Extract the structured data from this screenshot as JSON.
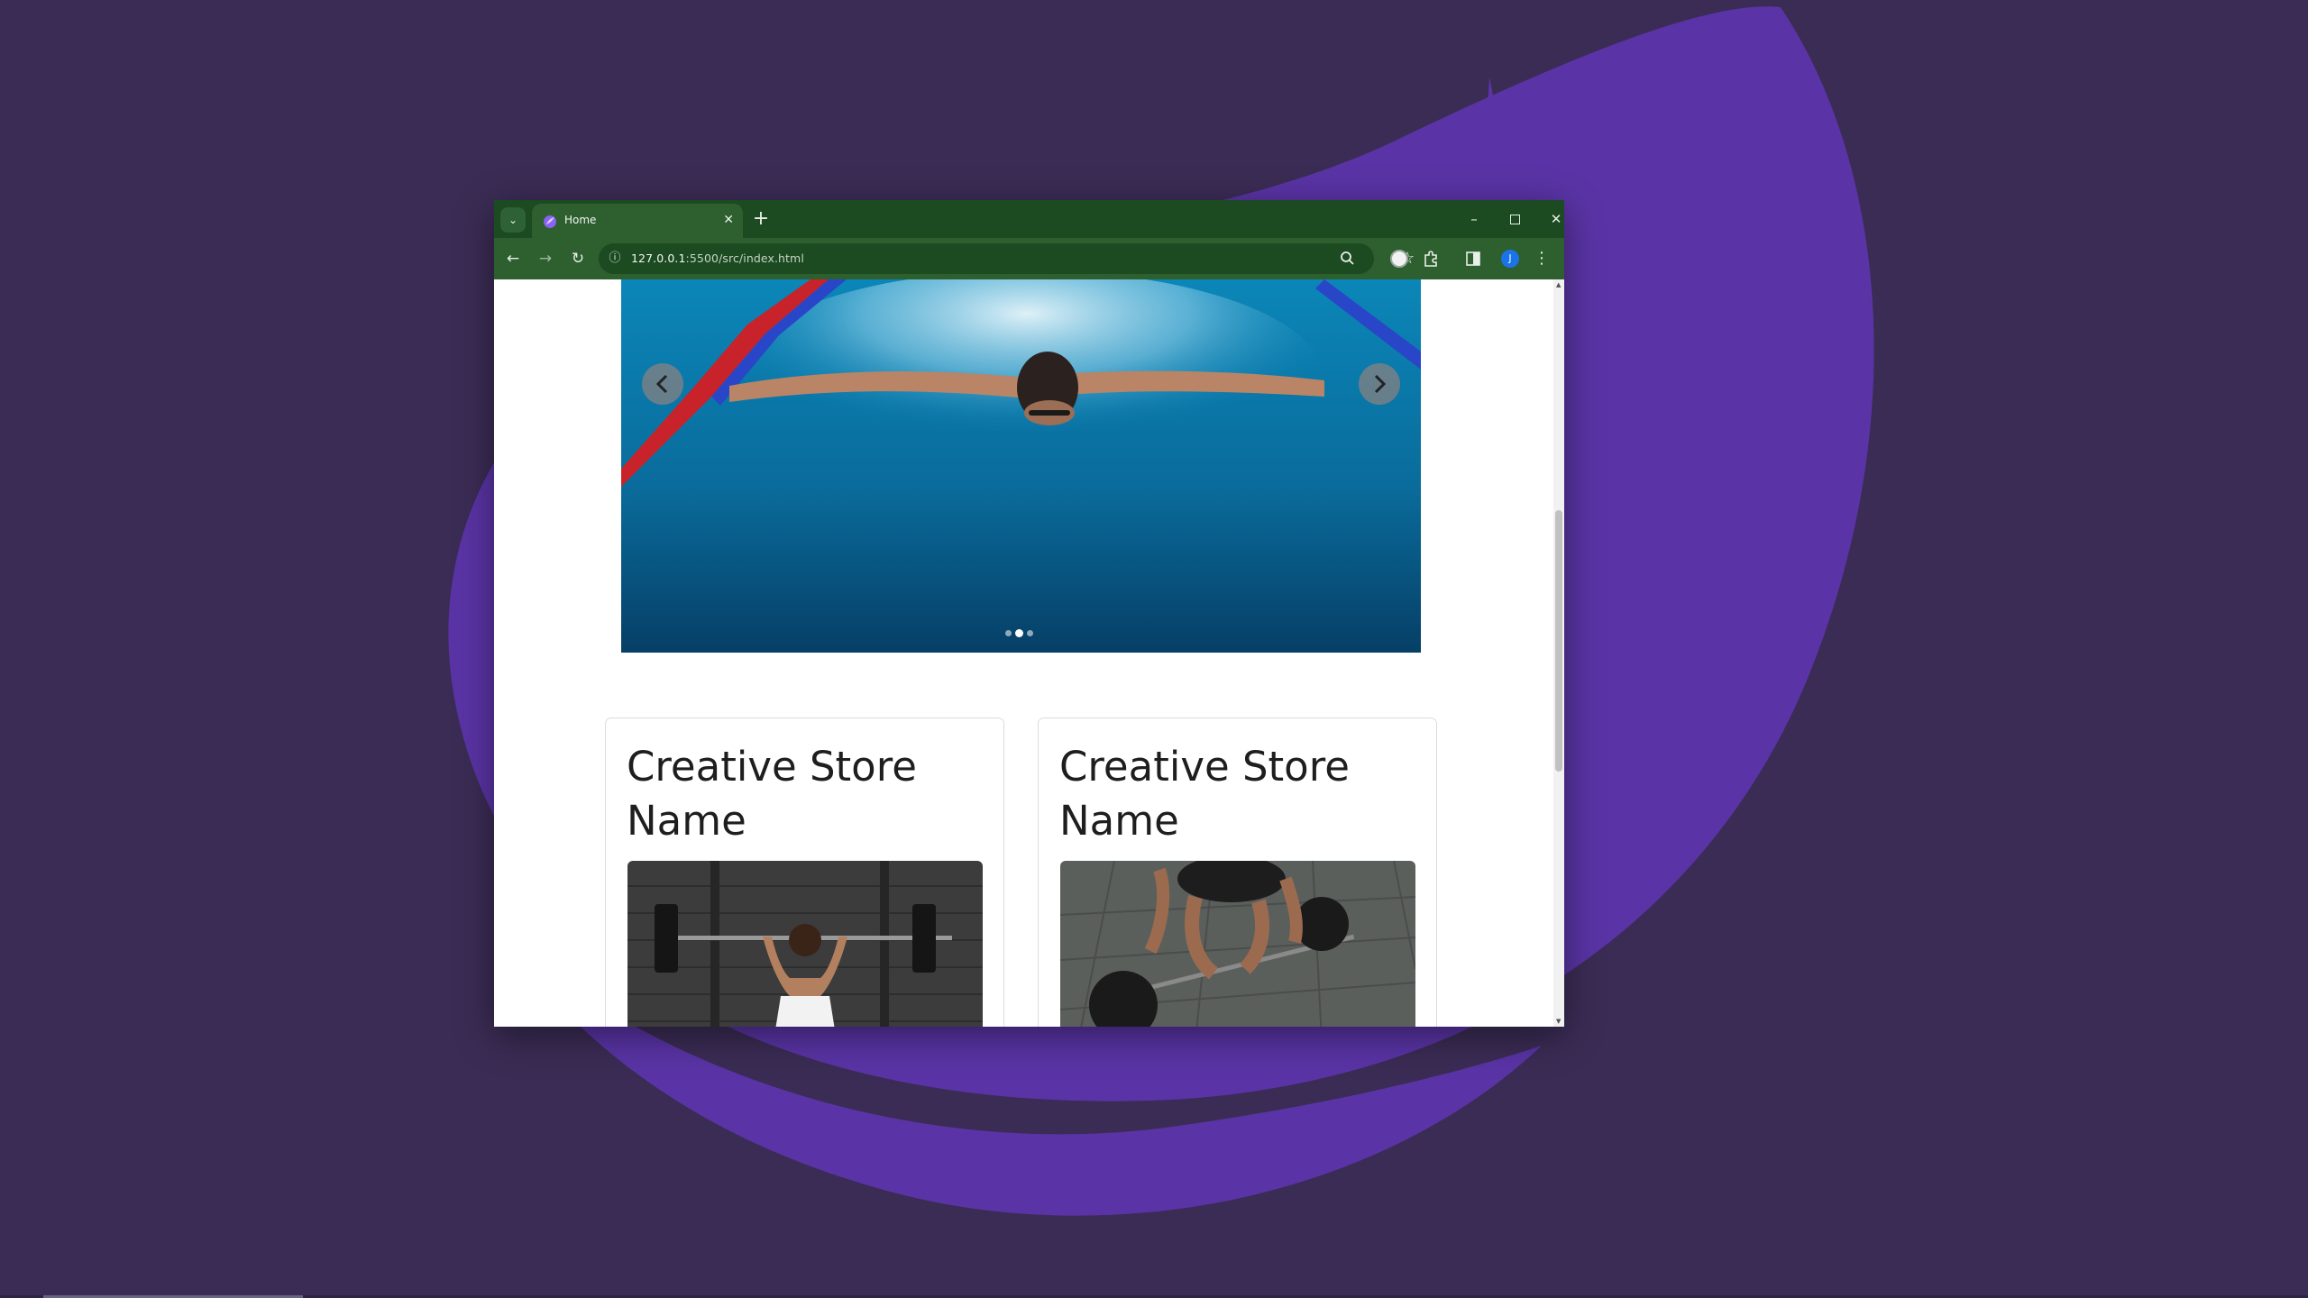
{
  "browser": {
    "tab": {
      "title": "Home"
    },
    "address_bar": {
      "url_host": "127.0.0.1",
      "url_rest": ":5500/src/index.html"
    },
    "profile_initial": "J"
  },
  "page": {
    "carousel": {
      "slide_count": 3,
      "active_slide": 2
    },
    "cards": [
      {
        "title": "Creative Store Name"
      },
      {
        "title": "Creative Store Name"
      }
    ]
  },
  "colors": {
    "desktop_background": "#3b2c55",
    "desktop_swoosh": "#5a34a6",
    "browser_frame": "#1c4a21",
    "browser_toolbar": "#2d5f2f"
  }
}
